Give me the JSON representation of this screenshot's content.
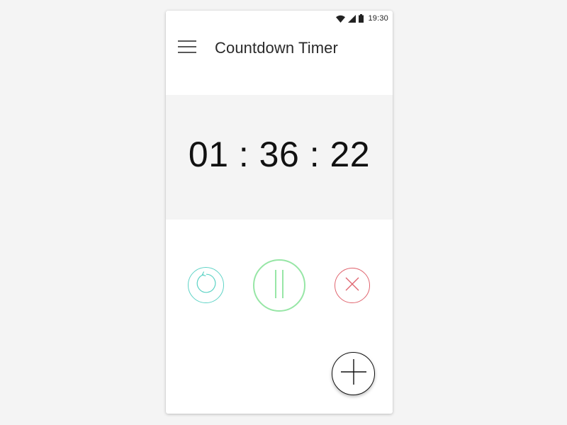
{
  "status_bar": {
    "time": "19:30",
    "icons": [
      "wifi-icon",
      "signal-icon",
      "battery-icon"
    ]
  },
  "app_bar": {
    "title": "Countdown Timer",
    "menu_icon": "hamburger-menu-icon"
  },
  "timer": {
    "display": "01 : 36 : 22"
  },
  "controls": {
    "reset_icon": "refresh-icon",
    "pause_icon": "pause-icon",
    "cancel_icon": "close-icon"
  },
  "fab": {
    "icon": "plus-icon"
  },
  "colors": {
    "background": "#f4f4f4",
    "card": "#ffffff",
    "timer_panel": "#f4f4f4",
    "reset": "#5ed3c6",
    "pause": "#97e6a6",
    "cancel": "#e0656f",
    "text": "#111111"
  }
}
